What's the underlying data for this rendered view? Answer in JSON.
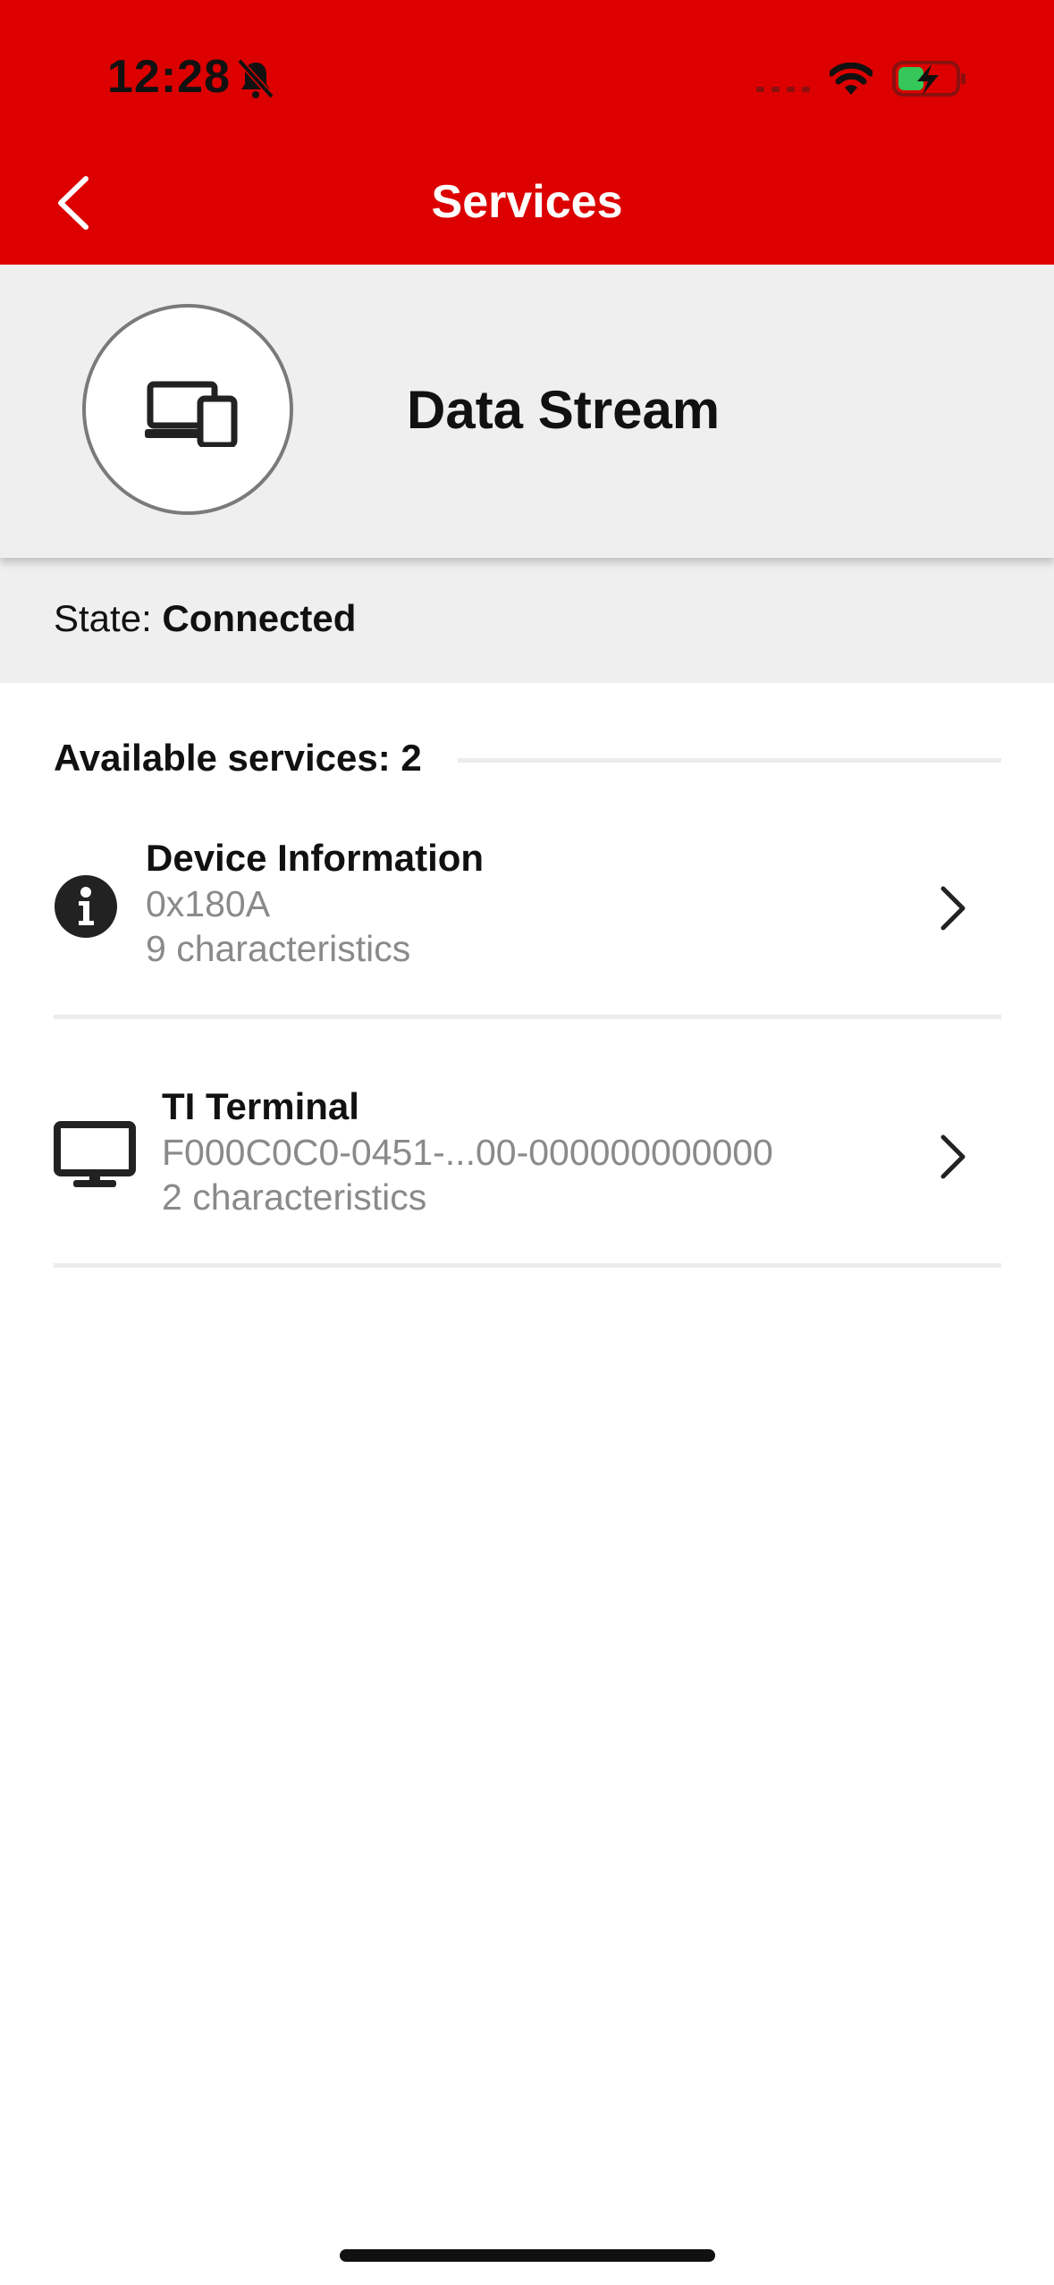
{
  "status_bar": {
    "time": "12:28",
    "icons": [
      "bell-slash-icon",
      "cellular-signal-icon",
      "wifi-icon",
      "battery-charging-icon"
    ]
  },
  "nav": {
    "title": "Services",
    "back_icon": "chevron-left-icon"
  },
  "device": {
    "name": "Data Stream",
    "icon": "devices-icon"
  },
  "state": {
    "label": "State:",
    "value": "Connected"
  },
  "services": {
    "header": "Available services: 2",
    "items": [
      {
        "icon": "info-icon",
        "name": "Device Information",
        "uuid": "0x180A",
        "characteristics": "9 characteristics"
      },
      {
        "icon": "monitor-icon",
        "name": "TI Terminal",
        "uuid": "F000C0C0-0451-...00-000000000000",
        "characteristics": "2 characteristics"
      }
    ]
  },
  "colors": {
    "brand_red": "#dc0000",
    "header_gray": "#efefef",
    "secondary_text": "#8a8a8a"
  }
}
